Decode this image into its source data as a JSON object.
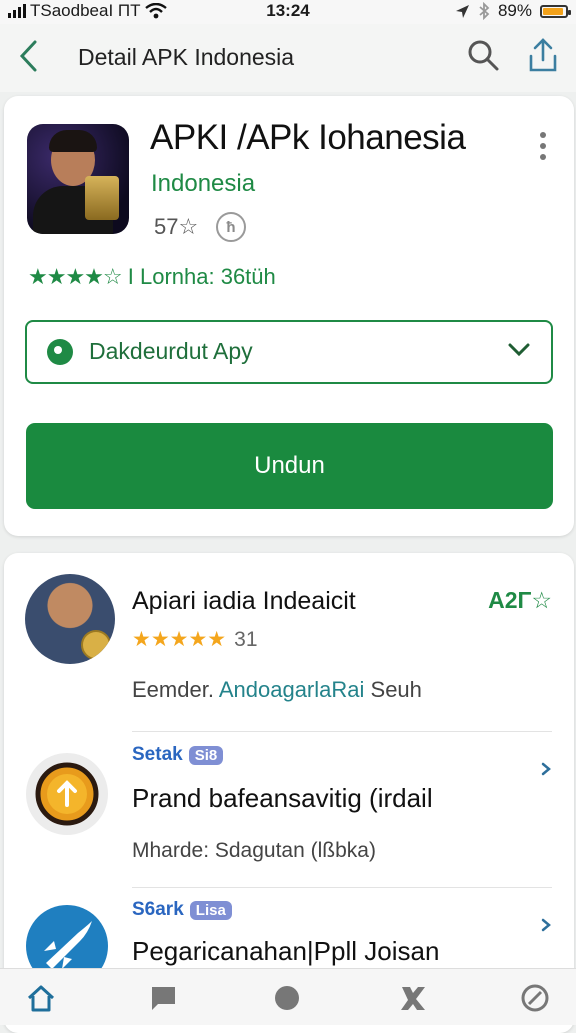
{
  "status_bar": {
    "carrier": "TSaodbeaI ΠΤ",
    "time": "13:24",
    "battery": "89%",
    "battery_level": 0.89
  },
  "app_bar": {
    "title": "Detail APK Indonesia",
    "icons": [
      "back-arrow-icon",
      "search-icon",
      "share-icon"
    ]
  },
  "app_card": {
    "title": "APKI /APk Iohanesia",
    "subtitle": "Indonesia",
    "rating_small": "57☆",
    "badge_glyph": "ħ",
    "stars": "★★★★☆",
    "stars_label": "I Lornha: 36tüh",
    "dropdown_label": "Dakdeurdut Apy",
    "primary_button": "Undun",
    "colors": {
      "accent": "#1a8a3f"
    }
  },
  "detail_card": {
    "header": {
      "title": "Apiari iadia Indeaicit",
      "score": "A2Γ☆",
      "stars": "★★★★★",
      "rating_count": "31",
      "meta_prefix": "Eemder.",
      "meta_link": "AndoagarlaRai",
      "meta_suffix": "Seuh"
    },
    "items": [
      {
        "tag": "Setak",
        "pill": "Si8",
        "title": "Prand bafeansavitig (irdail",
        "sub": "Mharde: Sdagutan (lßbka)",
        "icon": "upload-badge-icon"
      },
      {
        "tag": "S6ark",
        "pill": "Lisa",
        "title": "Pegaricanahan|Ppll Joisan",
        "sub": "",
        "icon": "rocket-icon"
      }
    ]
  },
  "bottom_nav": {
    "items": [
      "home-icon",
      "chat-icon",
      "circle-icon",
      "tool-icon",
      "compass-icon"
    ],
    "active": "home-icon"
  }
}
